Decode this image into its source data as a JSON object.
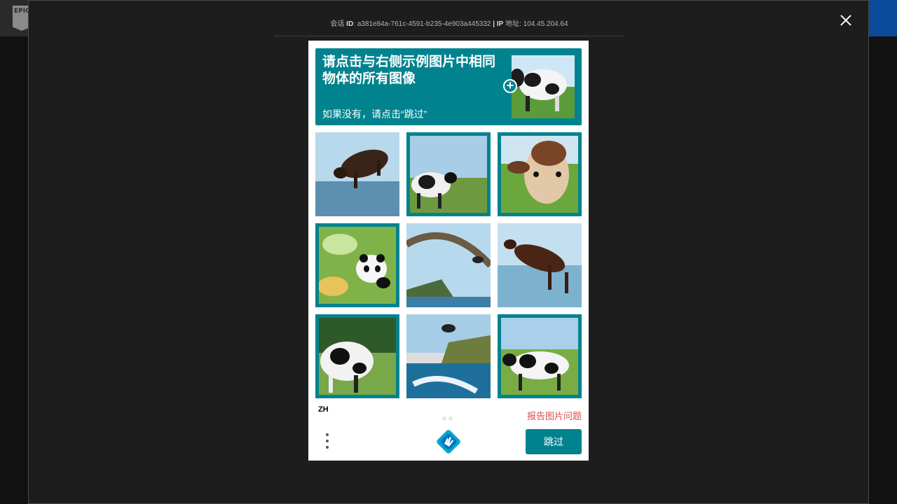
{
  "session": {
    "id_prefix": "会话",
    "id_label": "ID",
    "id_value": "a381e84a-761c-4591-b235-4e903a445332",
    "separator": "|",
    "ip_label": "IP",
    "ip_suffix": "地址",
    "ip_value": "104.45.204.64"
  },
  "captcha": {
    "prompt_title": "请点击与右侧示例图片中相同物体的所有图像",
    "prompt_hint": "如果没有，请点击“跳过”",
    "plus_symbol": "+",
    "language": "ZH",
    "report_label": "报告图片问题",
    "submit_label": "跳过",
    "selected_tiles": [
      1,
      2,
      3,
      6,
      8
    ],
    "page_count": 2
  },
  "logo": {
    "brand_text": "EPIC"
  },
  "colors": {
    "accent": "#00838f",
    "report": "#e04b4b",
    "overlay": "#1d1d1d"
  }
}
